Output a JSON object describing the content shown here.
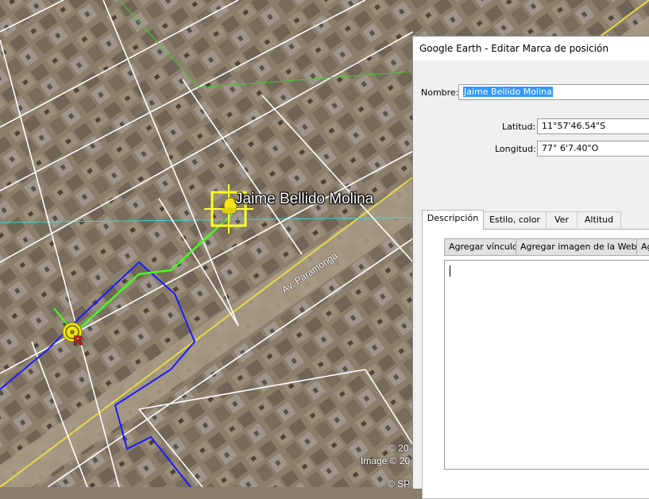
{
  "map": {
    "place_label": "Jaime Bellido Molina",
    "street_label": "Av. Paramonga",
    "copyright_1": "© 20",
    "copyright_2": "Image © 20",
    "copyright_3": "© SP",
    "colors": {
      "route_blue": "#1a1aff",
      "path_green": "#44ff22",
      "road_yellow": "#e8d84a",
      "gridline": "#ffffff",
      "horizon_cyan": "#33dddd"
    }
  },
  "dialog": {
    "title": "Google Earth - Editar Marca de posición",
    "name_label": "Nombre:",
    "name_value": "Jaime Bellido Molina",
    "lat_label": "Latitud:",
    "lat_value": "11°57'46.54\"S",
    "lon_label": "Longitud:",
    "lon_value": "77° 6'7.40\"O",
    "tabs": [
      {
        "label": "Descripción",
        "active": true
      },
      {
        "label": "Estilo, color",
        "active": false
      },
      {
        "label": "Ver",
        "active": false
      },
      {
        "label": "Altitud",
        "active": false
      }
    ],
    "buttons": {
      "add_link": "Agregar vínculo",
      "add_web_image": "Agregar imagen de la Web...",
      "add_local_image": "Ag"
    },
    "description_value": ""
  }
}
